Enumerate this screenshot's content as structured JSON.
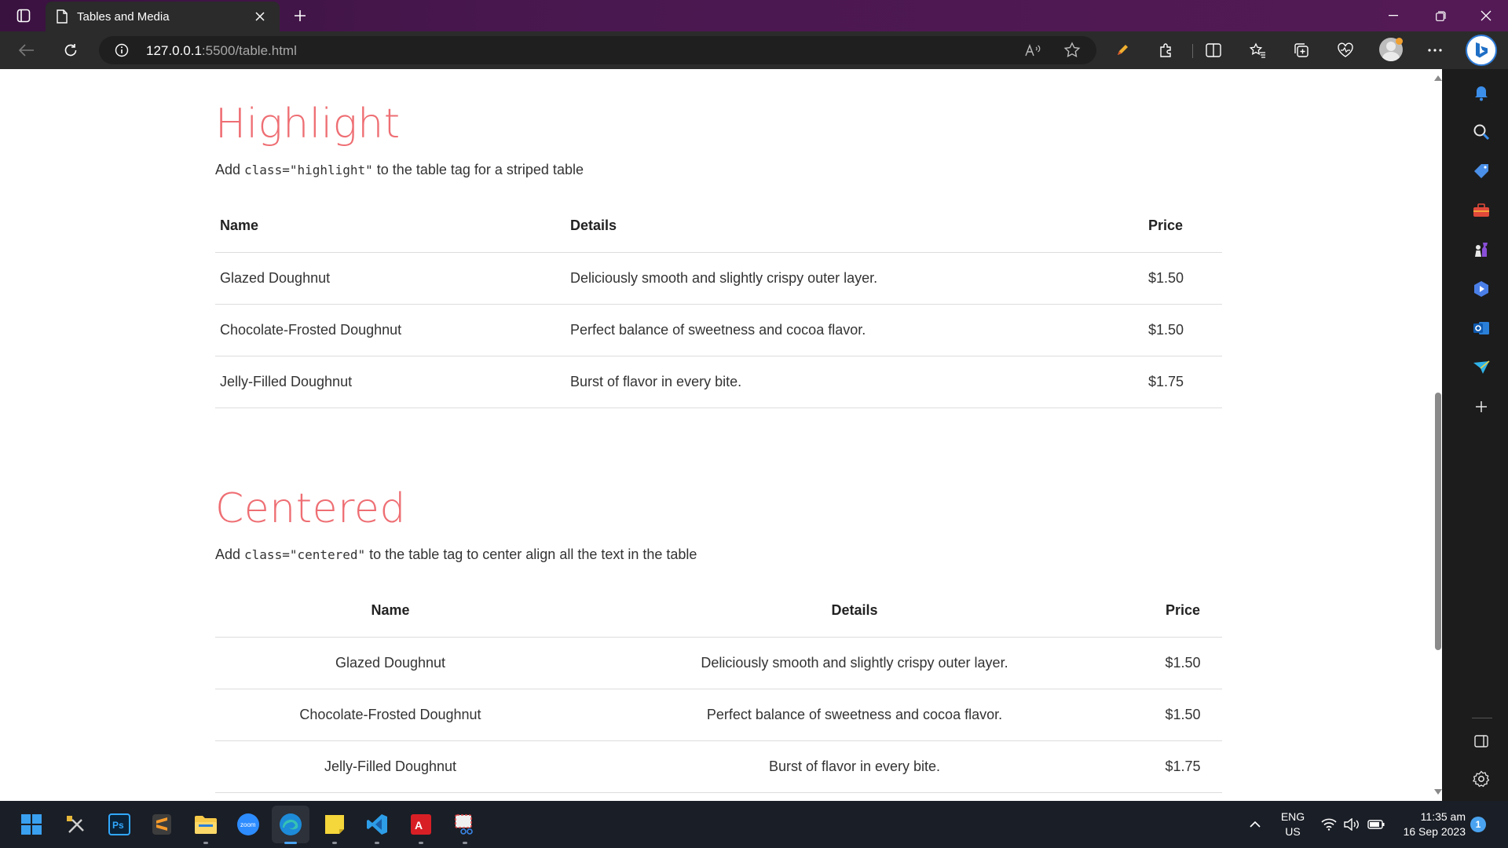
{
  "browser": {
    "tab_title": "Tables and Media",
    "url_host": "127.0.0.1",
    "url_path": ":5500/table.html"
  },
  "sections": [
    {
      "heading": "Highlight",
      "desc_prefix": "Add ",
      "desc_code": "class=\"highlight\"",
      "desc_suffix": " to the table tag for a striped table",
      "headers": [
        "Name",
        "Details",
        "Price"
      ],
      "rows": [
        [
          "Glazed Doughnut",
          "Deliciously smooth and slightly crispy outer layer.",
          "$1.50"
        ],
        [
          "Chocolate-Frosted Doughnut",
          "Perfect balance of sweetness and cocoa flavor.",
          "$1.50"
        ],
        [
          "Jelly-Filled Doughnut",
          "Burst of flavor in every bite.",
          "$1.75"
        ]
      ]
    },
    {
      "heading": "Centered",
      "desc_prefix": "Add ",
      "desc_code": "class=\"centered\"",
      "desc_suffix": " to the table tag to center align all the text in the table",
      "headers": [
        "Name",
        "Details",
        "Price"
      ],
      "rows": [
        [
          "Glazed Doughnut",
          "Deliciously smooth and slightly crispy outer layer.",
          "$1.50"
        ],
        [
          "Chocolate-Frosted Doughnut",
          "Perfect balance of sweetness and cocoa flavor.",
          "$1.50"
        ],
        [
          "Jelly-Filled Doughnut",
          "Burst of flavor in every bite.",
          "$1.75"
        ]
      ]
    }
  ],
  "taskbar": {
    "lang_top": "ENG",
    "lang_bottom": "US",
    "time": "11:35 am",
    "date": "16 Sep 2023",
    "notification_count": "1"
  },
  "colors": {
    "heading_accent": "#ee6e73",
    "titlebar": "#4a1850",
    "edge_active": "#4aa3f0"
  },
  "icons": {
    "sidebar": [
      "bell-icon",
      "search-icon",
      "tag-icon",
      "toolbox-icon",
      "chess-icon",
      "copilot-icon",
      "outlook-icon",
      "send-icon",
      "add-icon",
      "sidebar-panel-icon",
      "settings-icon"
    ],
    "taskbar": [
      "windows-start-icon",
      "tools-icon",
      "photoshop-icon",
      "sublime-icon",
      "file-explorer-icon",
      "zoom-icon",
      "edge-icon",
      "sticky-notes-icon",
      "vscode-icon",
      "acrobat-icon",
      "snipping-tool-icon"
    ]
  }
}
